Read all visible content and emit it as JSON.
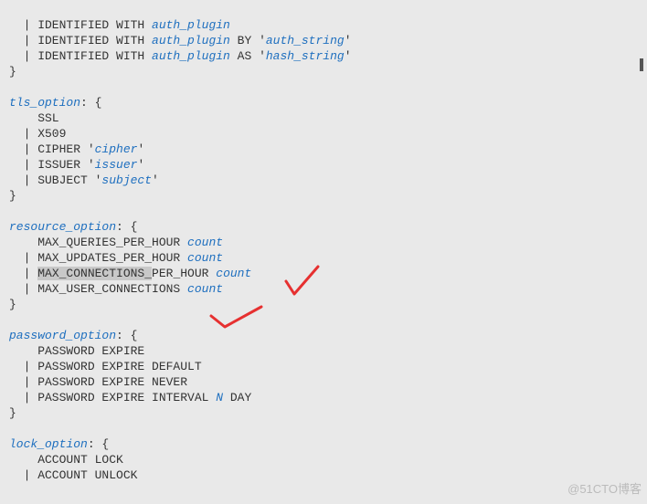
{
  "watermark": "@51CTO博客",
  "lines": {
    "l1a": "  | IDENTIFIED WITH ",
    "l1b": "auth_plugin",
    "l2a": "  | IDENTIFIED WITH ",
    "l2b": "auth_plugin",
    "l2c": " BY '",
    "l2d": "auth_string",
    "l2e": "'",
    "l3a": "  | IDENTIFIED WITH ",
    "l3b": "auth_plugin",
    "l3c": " AS '",
    "l3d": "hash_string",
    "l3e": "'",
    "l4": "}",
    "blank": " ",
    "tls_a": "tls_option",
    "tls_b": ": {",
    "tls_ssl": "    SSL",
    "tls_x509": "  | X509",
    "tls_cipher_a": "  | CIPHER '",
    "tls_cipher_b": "cipher",
    "tls_cipher_c": "'",
    "tls_issuer_a": "  | ISSUER '",
    "tls_issuer_b": "issuer",
    "tls_issuer_c": "'",
    "tls_subject_a": "  | SUBJECT '",
    "tls_subject_b": "subject",
    "tls_subject_c": "'",
    "close": "}",
    "res_a": "resource_option",
    "res_b": ": {",
    "res1a": "    MAX_QUERIES_PER_HOUR ",
    "res1b": "count",
    "res2a": "  | MAX_UPDATES_PER_HOUR ",
    "res2b": "count",
    "res3a": "  | ",
    "res3h": "MAX_CONNECTIONS_",
    "res3c": "PER_HOUR ",
    "res3d": "count",
    "res4a": "  | MAX_USER_CONNECTIONS ",
    "res4b": "count",
    "pw_a": "password_option",
    "pw_b": ": {",
    "pw1": "    PASSWORD EXPIRE",
    "pw2": "  | PASSWORD EXPIRE DEFAULT",
    "pw3": "  | PASSWORD EXPIRE NEVER",
    "pw4a": "  | PASSWORD EXPIRE INTERVAL ",
    "pw4b": "N",
    "pw4c": " DAY",
    "lock_a": "lock_option",
    "lock_b": ": {",
    "lock1": "    ACCOUNT LOCK",
    "lock2": "  | ACCOUNT UNLOCK"
  }
}
